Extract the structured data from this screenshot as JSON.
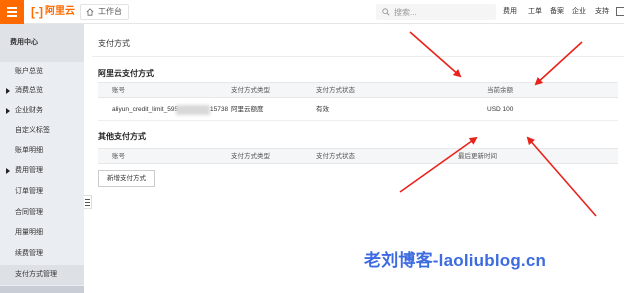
{
  "topbar": {
    "logo_text": "阿里云",
    "workbench_label": "工作台",
    "search_placeholder": "搜索...",
    "nav": [
      "费用",
      "工单",
      "备案",
      "企业",
      "支持"
    ]
  },
  "sidebar": {
    "title": "费用中心",
    "items": [
      {
        "label": "账户总览",
        "expandable": false
      },
      {
        "label": "消费总览",
        "expandable": true
      },
      {
        "label": "企业财务",
        "expandable": true
      },
      {
        "label": "自定义标签",
        "expandable": false
      },
      {
        "label": "账单明细",
        "expandable": false
      },
      {
        "label": "费用管理",
        "expandable": true
      },
      {
        "label": "订单管理",
        "expandable": false
      },
      {
        "label": "合同管理",
        "expandable": false
      },
      {
        "label": "用量明细",
        "expandable": false
      },
      {
        "label": "续费管理",
        "expandable": false
      },
      {
        "label": "支付方式管理",
        "expandable": false,
        "active": true
      }
    ]
  },
  "main": {
    "page_title": "支付方式",
    "aliyun_section": {
      "title": "阿里云支付方式",
      "columns": [
        "账号",
        "支付方式类型",
        "支付方式状态",
        "当前余额"
      ],
      "rows": [
        {
          "account_prefix": "aliyun_credit_limit_595",
          "account_suffix": "15738",
          "type": "阿里云额度",
          "status": "有效",
          "balance": "USD 100"
        }
      ]
    },
    "other_section": {
      "title": "其他支付方式",
      "columns": [
        "账号",
        "支付方式类型",
        "支付方式状态",
        "最后更新时间"
      ],
      "add_button": "新增支付方式"
    }
  },
  "watermark": "老刘博客-laoliublog.cn",
  "colors": {
    "accent": "#ff6a00",
    "arrow": "#e8231b",
    "watermark": "#3d6be0",
    "sidebar_bg": "#eaedf1"
  }
}
